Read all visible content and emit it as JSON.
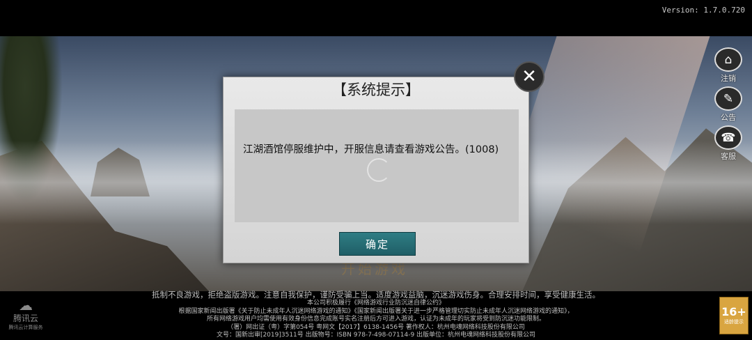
{
  "app": {
    "version": "Version: 1.7.0.720"
  },
  "background": {
    "start_text": "开始游戏"
  },
  "side_buttons": [
    {
      "label": "注销",
      "icon": "logout-icon",
      "glyph": "⌂"
    },
    {
      "label": "公告",
      "icon": "announcement-icon",
      "glyph": "✎"
    },
    {
      "label": "客服",
      "icon": "customer-service-icon",
      "glyph": "☎"
    }
  ],
  "dialog": {
    "title": "【系统提示】",
    "message": "江湖酒馆停服维护中，开服信息请查看游戏公告。(1008)",
    "ok_label": "确定",
    "close_icon": "close-icon"
  },
  "footer": {
    "line1": "抵制不良游戏，拒绝盗版游戏。注意自我保护，谨防受骗上当。适度游戏益脑，沉迷游戏伤身。合理安排时间，享受健康生活。",
    "line2": "本公司积极履行《网络游戏行业防沉迷自律公约》",
    "line3": "根据国家新闻出版署《关于防止未成年人沉迷网络游戏的通知》《国家新闻出版署关于进一步严格管理切实防止未成年人沉迷网络游戏的通知》，",
    "line4": "所有网络游戏用户均需使用有效身份信息完成账号实名注册后方可进入游戏，认证为未成年的玩家将受到防沉迷功能限制。",
    "line5": "（署）网出证（粤）字第054号 粤网文【2017】6138-1456号 著作权人：杭州电魂网络科技股份有限公司",
    "line6": "文号：国新出审[2019]3511号 出版物号：ISBN 978-7-498-07114-9 出版单位：杭州电魂网络科技股份有限公司"
  },
  "cloud_logo": {
    "name": "腾讯云",
    "sub": "腾讯云计算服务"
  },
  "age_rating": {
    "value": "16+",
    "label": "适龄提示"
  },
  "colors": {
    "ok_button": "#2a7078",
    "age_badge": "#d9a540"
  }
}
